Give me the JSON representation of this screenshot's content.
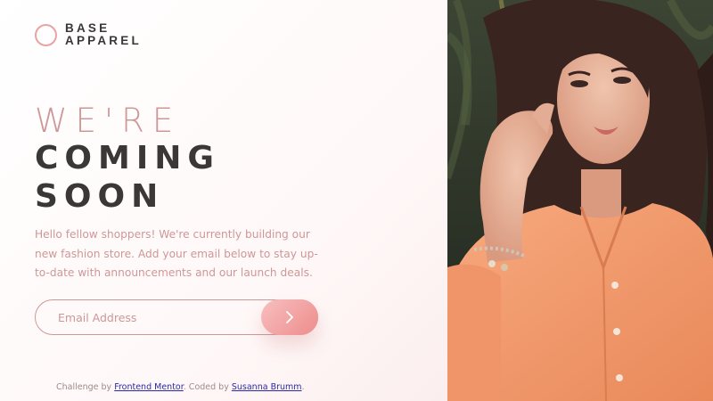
{
  "logo": {
    "line1": "BASE",
    "line2": "APPAREL"
  },
  "headline": {
    "light": "WE'RE",
    "bold1": "COMING",
    "bold2": "SOON"
  },
  "description": "Hello fellow shoppers! We're currently building our new fashion store. Add your email below to stay up-to-date with announcements and our launch deals.",
  "form": {
    "placeholder": "Email Address",
    "submit_icon": "chevron-right-icon"
  },
  "footer": {
    "prefix": "Challenge by ",
    "link1": "Frontend Mentor",
    "middle": ". Coded by ",
    "link2": "Susanna Brumm",
    "suffix": "."
  },
  "colors": {
    "accent": "#ce9797",
    "dark": "#3b3637",
    "button_start": "#f8bfbf",
    "button_end": "#ee8c8c",
    "shirt": "#f59f72"
  }
}
